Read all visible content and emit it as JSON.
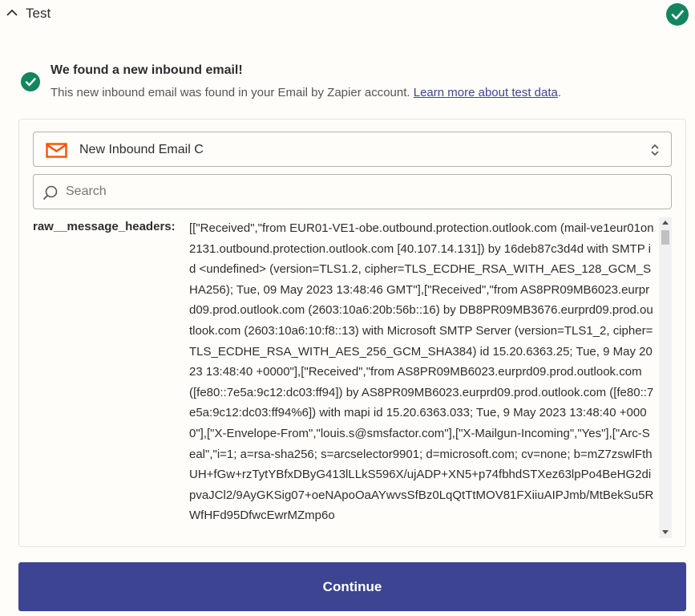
{
  "header": {
    "title": "Test",
    "collapse_icon": "chevron-up-icon",
    "status_icon": "check-circle-icon"
  },
  "result": {
    "icon": "check-circle-icon",
    "title": "We found a new inbound email!",
    "description": "This new inbound email was found in your Email by Zapier account. ",
    "link_text": "Learn more about test data",
    "trailing": "."
  },
  "record_select": {
    "icon": "mail-icon",
    "value": "New Inbound Email C",
    "icon_color": "#ff4f00"
  },
  "search": {
    "placeholder": "Search",
    "value": ""
  },
  "field": {
    "key": "raw__message_headers:",
    "value": "[[\"Received\",\"from EUR01-VE1-obe.outbound.protection.outlook.com (mail-ve1eur01on2131.outbound.protection.outlook.com [40.107.14.131]) by 16deb87c3d4d with SMTP id <undefined> (version=TLS1.2, cipher=TLS_ECDHE_RSA_WITH_AES_128_GCM_SHA256); Tue, 09 May 2023 13:48:46 GMT\"],[\"Received\",\"from AS8PR09MB6023.eurprd09.prod.outlook.com (2603:10a6:20b:56b::16) by DB8PR09MB3676.eurprd09.prod.outlook.com (2603:10a6:10:f8::13) with Microsoft SMTP Server (version=TLS1_2, cipher=TLS_ECDHE_RSA_WITH_AES_256_GCM_SHA384) id 15.20.6363.25; Tue, 9 May 2023 13:48:40 +0000\"],[\"Received\",\"from AS8PR09MB6023.eurprd09.prod.outlook.com ([fe80::7e5a:9c12:dc03:ff94]) by AS8PR09MB6023.eurprd09.prod.outlook.com ([fe80::7e5a:9c12:dc03:ff94%6]) with mapi id 15.20.6363.033; Tue, 9 May 2023 13:48:40 +0000\"],[\"X-Envelope-From\",\"louis.s@smsfactor.com\"],[\"X-Mailgun-Incoming\",\"Yes\"],[\"Arc-Seal\",\"i=1; a=rsa-sha256; s=arcselector9901; d=microsoft.com; cv=none; b=mZ7zswlFthUH+fGw+rzTytYBfxDByG413lLLkS596X/ujADP+XN5+p74fbhdSTXez63lpPo4BeHG2dipvaJCl2/9AyGKSig07+oeNApoOaAYwvsSfBz0LqQtTtMOV81FXiiuAIPJmb/MtBekSu5RWfHFd95DfwcEwrMZmp6o"
  },
  "actions": {
    "continue_label": "Continue"
  },
  "colors": {
    "success": "#13855f",
    "primary": "#3d4592",
    "link": "#3d4592"
  }
}
